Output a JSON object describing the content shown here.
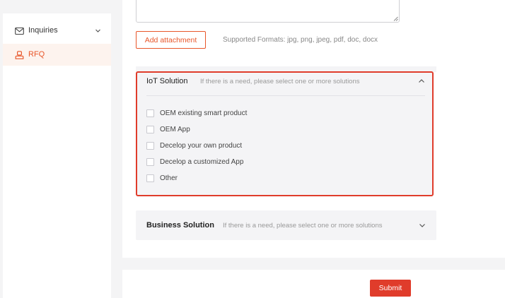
{
  "sidebar": {
    "items": [
      {
        "label": "Inquiries",
        "icon": "mail-icon",
        "has_chevron": true
      },
      {
        "label": "RFQ",
        "icon": "user-icon",
        "active": true
      }
    ]
  },
  "form": {
    "attachment": {
      "button_label": "Add attachment",
      "supported_formats": "Supported Formats: jpg, png, jpeg, pdf, doc, docx"
    },
    "iot_solution": {
      "title": "IoT Solution",
      "hint": "If there is a need, please select one or more solutions",
      "expanded": true,
      "options": [
        {
          "label": "OEM existing smart product",
          "checked": false
        },
        {
          "label": "OEM App",
          "checked": false
        },
        {
          "label": "Decelop your own product",
          "checked": false
        },
        {
          "label": "Decelop a customized App",
          "checked": false
        },
        {
          "label": "Other",
          "checked": false
        }
      ]
    },
    "business_solution": {
      "title": "Business Solution",
      "hint": "If there is a need, please select one or more solutions",
      "expanded": false
    },
    "submit_label": "Submit"
  },
  "colors": {
    "accent": "#e8562a",
    "highlight_border": "#e03c2b",
    "submit_bg": "#e03c2b",
    "panel_bg": "#f4f4f6"
  }
}
